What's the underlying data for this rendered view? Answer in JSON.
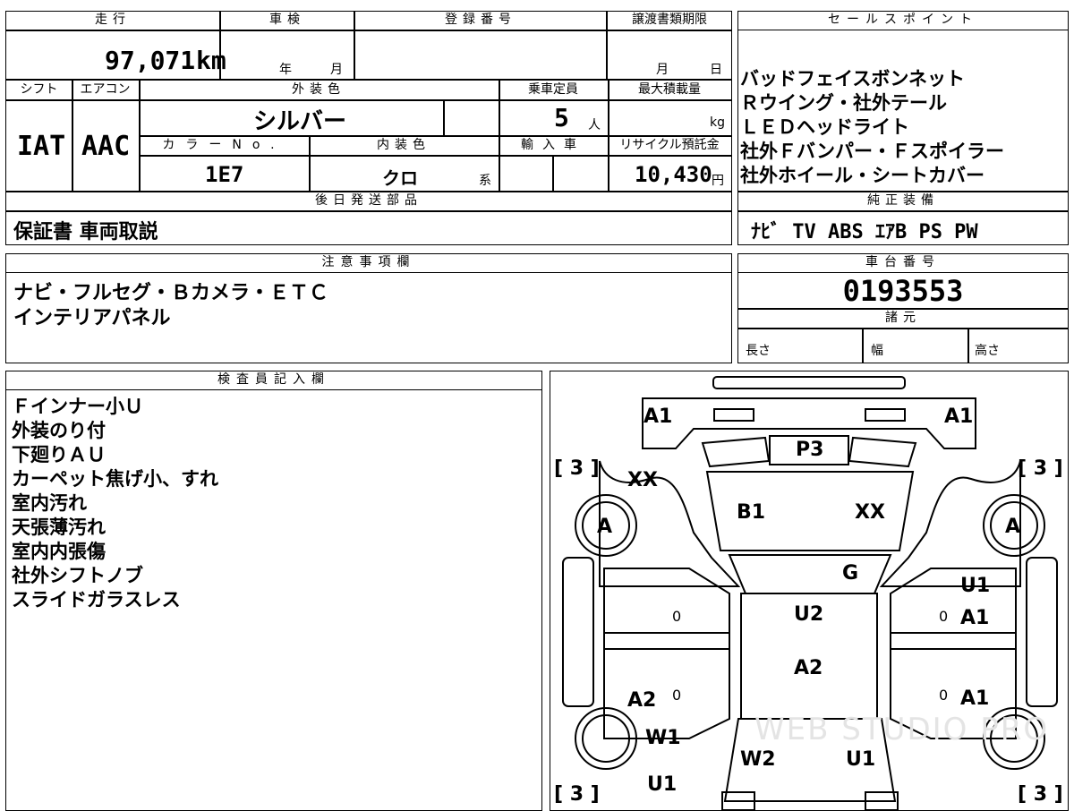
{
  "top": {
    "headers": [
      "走行",
      "車検",
      "登録番号",
      "譲渡書類期限"
    ],
    "mileage": "97,071",
    "mileage_unit": "km",
    "shaken_year": "年",
    "shaken_month": "月",
    "joto_month": "月",
    "joto_day": "日"
  },
  "row2": {
    "headers": [
      "シフト",
      "エアコン",
      "外装色",
      "乗車定員",
      "最大積載量"
    ],
    "shift": "IAT",
    "aircon": "AAC",
    "exterior_color": "シルバー",
    "capacity": "5",
    "capacity_unit": "人",
    "load_unit": "kg"
  },
  "row3": {
    "headers": [
      "カラーNo.",
      "内装色",
      "輸入車",
      "リサイクル預託金"
    ],
    "color_no": "1E7",
    "interior_color": "クロ",
    "interior_suffix": "系",
    "recycle_fee": "10,430",
    "recycle_unit": "円"
  },
  "later_parts": {
    "header": "後日発送部品",
    "value": "保証書 車両取説"
  },
  "sales_point": {
    "header": "セールスポイント",
    "lines": [
      "バッドフェイスボンネット",
      "Ｒウイング・社外テール",
      "ＬＥＤヘッドライト",
      "社外Ｆバンパー・Ｆスポイラー",
      "社外ホイール・シートカバー"
    ]
  },
  "genuine_equipment": {
    "header": "純正装備",
    "value": "ﾅﾋﾞ TV ABS ｴｱB PS PW"
  },
  "notes": {
    "header": "注意事項欄",
    "lines": [
      "ナビ・フルセグ・Ｂカメラ・ＥＴＣ",
      "インテリアパネル"
    ]
  },
  "chassis": {
    "header": "車台番号",
    "number": "0193553"
  },
  "specs": {
    "header": "諸元",
    "length": "長さ",
    "width": "幅",
    "height": "高さ"
  },
  "inspector": {
    "header": "検査員記入欄",
    "lines": [
      "Ｆインナー小Ｕ",
      "外装のり付",
      "下廻りＡＵ",
      "カーペット焦げ小、すれ",
      "室内汚れ",
      "天張薄汚れ",
      "室内内張傷",
      "社外シフトノブ",
      "スライドガラスレス"
    ]
  },
  "diagram": {
    "marks": {
      "a1_left": "A1",
      "a1_right": "A1",
      "p3": "P3",
      "bracket_tl": "[ 3 ]",
      "bracket_tr": "[ 3 ]",
      "bracket_bl": "[ 3 ]",
      "bracket_br": "[ 3 ]",
      "xx_left": "XX",
      "xx_right": "XX",
      "b1": "B1",
      "g": "G",
      "wheel_fl": "A",
      "wheel_fr": "A",
      "u1_right": "U1",
      "a1_right_front": "A1",
      "u2": "U2",
      "a2_center": "A2",
      "a2_left": "A2",
      "a1_right_rear": "A1",
      "w1": "W1",
      "w2": "W2",
      "u1_center": "U1",
      "u1_left": "U1",
      "zero_1": "0",
      "zero_2": "0",
      "zero_3": "0",
      "zero_4": "0"
    },
    "watermark": "WEB STUDIO PRO"
  }
}
